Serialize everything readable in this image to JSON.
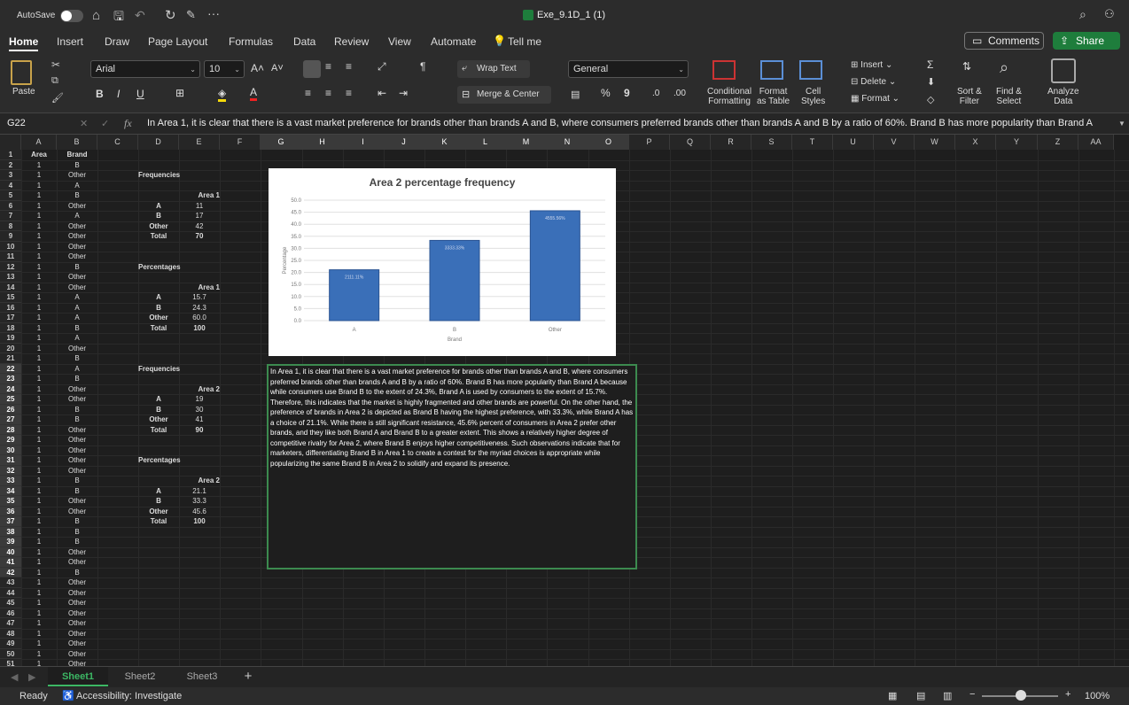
{
  "title_bar": {
    "autosave_label": "AutoSave",
    "file_name": "Exe_9.1D_1 (1)"
  },
  "menu_tabs": [
    "Home",
    "Insert",
    "Draw",
    "Page Layout",
    "Formulas",
    "Data",
    "Review",
    "View",
    "Automate",
    "Tell me"
  ],
  "comments_label": "Comments",
  "share_label": "Share",
  "ribbon": {
    "paste": "Paste",
    "font_name": "Arial",
    "font_size": "10",
    "wrap_text": "Wrap Text",
    "merge_center": "Merge & Center",
    "number_format": "General",
    "cond_fmt_1": "Conditional",
    "cond_fmt_2": "Formatting",
    "fmt_table_1": "Format",
    "fmt_table_2": "as Table",
    "cell_styles_1": "Cell",
    "cell_styles_2": "Styles",
    "insert": "Insert",
    "delete": "Delete",
    "format": "Format",
    "sort_1": "Sort &",
    "sort_2": "Filter",
    "find_1": "Find &",
    "find_2": "Select",
    "analyze_1": "Analyze",
    "analyze_2": "Data",
    "bold": "B",
    "italic": "I",
    "underline": "U",
    "percent": "%",
    "comma": "9"
  },
  "formula_bar": {
    "name_box": "G22",
    "fx": "fx",
    "content": "In Area 1, it is clear that there is a vast market preference for brands other than brands A and B, where consumers preferred brands other than brands A and B by a ratio of 60%. Brand B has more popularity than Brand A"
  },
  "columns": [
    "A",
    "B",
    "C",
    "D",
    "E",
    "F",
    "G",
    "H",
    "I",
    "J",
    "K",
    "L",
    "M",
    "N",
    "O",
    "P",
    "Q",
    "R",
    "S",
    "T",
    "U",
    "V",
    "W",
    "X",
    "Y",
    "Z",
    "AA"
  ],
  "rows": [
    "1",
    "2",
    "3",
    "4",
    "5",
    "6",
    "7",
    "8",
    "9",
    "10",
    "11",
    "12",
    "13",
    "14",
    "15",
    "16",
    "17",
    "18",
    "19",
    "20",
    "21",
    "22",
    "23",
    "24",
    "25",
    "26",
    "27",
    "28",
    "29",
    "30",
    "31",
    "32",
    "33",
    "34",
    "35",
    "36",
    "37",
    "38",
    "39",
    "40",
    "41",
    "42",
    "43",
    "44",
    "45",
    "46",
    "47",
    "48",
    "49",
    "50",
    "51"
  ],
  "colA": [
    "Area",
    "1",
    "1",
    "1",
    "1",
    "1",
    "1",
    "1",
    "1",
    "1",
    "1",
    "1",
    "1",
    "1",
    "1",
    "1",
    "1",
    "1",
    "1",
    "1",
    "1",
    "1",
    "1",
    "1",
    "1",
    "1",
    "1",
    "1",
    "1",
    "1",
    "1",
    "1",
    "1",
    "1",
    "1",
    "1",
    "1",
    "1",
    "1",
    "1",
    "1",
    "1",
    "1",
    "1",
    "1",
    "1",
    "1",
    "1",
    "1",
    "1",
    "1"
  ],
  "colB": [
    "Brand",
    "B",
    "Other",
    "A",
    "B",
    "Other",
    "A",
    "Other",
    "Other",
    "Other",
    "Other",
    "B",
    "Other",
    "Other",
    "A",
    "A",
    "A",
    "B",
    "A",
    "Other",
    "B",
    "A",
    "B",
    "Other",
    "Other",
    "B",
    "B",
    "Other",
    "Other",
    "Other",
    "Other",
    "Other",
    "B",
    "B",
    "Other",
    "Other",
    "B",
    "B",
    "B",
    "Other",
    "Other",
    "B",
    "Other",
    "Other",
    "Other",
    "Other",
    "Other",
    "Other",
    "Other",
    "Other",
    "Other"
  ],
  "table1": {
    "title": "Frequencies",
    "header": "Area 1",
    "labels": [
      "A",
      "B",
      "Other",
      "Total"
    ],
    "values": [
      "11",
      "17",
      "42",
      "70"
    ]
  },
  "table2": {
    "title": "Percentages",
    "header": "Area 1",
    "labels": [
      "A",
      "B",
      "Other",
      "Total"
    ],
    "values": [
      "15.7",
      "24.3",
      "60.0",
      "100"
    ]
  },
  "table3": {
    "title": "Frequencies",
    "header": "Area 2",
    "labels": [
      "A",
      "B",
      "Other",
      "Total"
    ],
    "values": [
      "19",
      "30",
      "41",
      "90"
    ]
  },
  "table4": {
    "title": "Percentages",
    "header": "Area 2",
    "labels": [
      "A",
      "B",
      "Other",
      "Total"
    ],
    "values": [
      "21.1",
      "33.3",
      "45.6",
      "100"
    ]
  },
  "chart_data": {
    "type": "bar",
    "title": "Area 2 percentage frequency",
    "xlabel": "Brand",
    "ylabel": "Percentage",
    "categories": [
      "A",
      "B",
      "Other"
    ],
    "values": [
      21.1,
      33.3,
      45.6
    ],
    "data_labels": [
      "2111.11%",
      "3333.33%",
      "4555.56%"
    ],
    "ylim": [
      0,
      50
    ],
    "yticks": [
      "0.0",
      "5.0",
      "10.0",
      "15.0",
      "20.0",
      "25.0",
      "30.0",
      "35.0",
      "40.0",
      "45.0",
      "50.0"
    ],
    "bar_color": "#3a6fb8",
    "grid": true
  },
  "textbox": "In Area 1, it is clear that there is a vast market preference for brands other than brands A and B, where consumers preferred brands other than brands A and B by a ratio of 60%. Brand B has more popularity than Brand A because while consumers use Brand B to the extent of 24.3%, Brand A is used by consumers to the extent of 15.7%. Therefore, this indicates that the market is highly fragmented and other brands are powerful. On the other hand, the preference of brands in Area 2 is depicted as Brand B having the highest preference, with 33.3%, while Brand A has a choice of 21.1%. While there is still significant resistance, 45.6% percent of consumers in Area 2 prefer other brands, and they like both Brand A and Brand B to a greater extent. This shows a relatively higher degree of competitive rivalry for Area 2, where Brand B enjoys higher competitiveness. Such observations indicate that for marketers, differentiating Brand B in Area 1 to create a contest for the myriad choices is appropriate while popularizing the same Brand B in Area 2 to solidify and expand its presence.",
  "sheets": [
    "Sheet1",
    "Sheet2",
    "Sheet3"
  ],
  "status": {
    "ready": "Ready",
    "accessibility": "Accessibility: Investigate",
    "zoom": "100%"
  },
  "colors": {
    "accent_green": "#1e7d3c",
    "selection_green": "#3c8a4f",
    "bar": "#3a6fb8"
  }
}
